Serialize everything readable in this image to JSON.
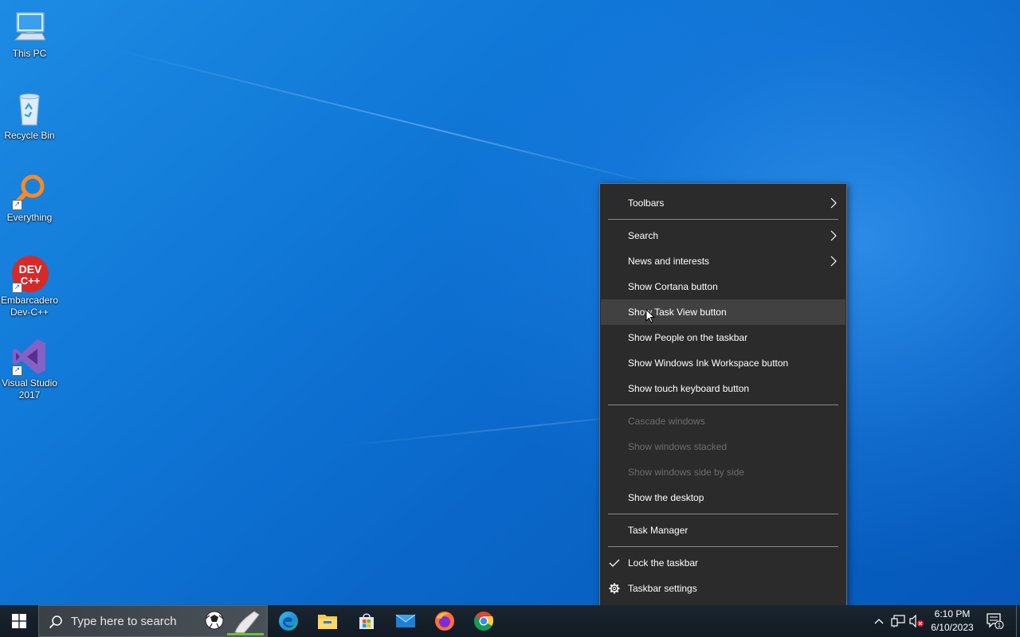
{
  "desktop": {
    "icons": [
      {
        "label": "This PC",
        "icon": "computer-icon"
      },
      {
        "label": "Recycle Bin",
        "icon": "recycle-bin-icon"
      },
      {
        "label": "Everything",
        "icon": "magnifier-icon"
      },
      {
        "label": "Embarcadero Dev-C++",
        "icon": "dev-cpp-icon",
        "badge": "DEV C++"
      },
      {
        "label": "Visual Studio 2017",
        "icon": "visual-studio-icon"
      }
    ]
  },
  "context_menu": {
    "items": [
      {
        "label": "Toolbars",
        "submenu": true
      },
      {
        "label": "Search",
        "submenu": true
      },
      {
        "label": "News and interests",
        "submenu": true
      },
      {
        "label": "Show Cortana button"
      },
      {
        "label": "Show Task View button",
        "hovered": true
      },
      {
        "label": "Show People on the taskbar"
      },
      {
        "label": "Show Windows Ink Workspace button"
      },
      {
        "label": "Show touch keyboard button"
      },
      {
        "label": "Cascade windows",
        "disabled": true
      },
      {
        "label": "Show windows stacked",
        "disabled": true
      },
      {
        "label": "Show windows side by side",
        "disabled": true
      },
      {
        "label": "Show the desktop"
      },
      {
        "label": "Task Manager"
      },
      {
        "label": "Lock the taskbar",
        "checked": true
      },
      {
        "label": "Taskbar settings",
        "icon": "gear-icon"
      }
    ]
  },
  "taskbar": {
    "search_placeholder": "Type here to search",
    "pinned": [
      "edge-icon",
      "file-explorer-icon",
      "microsoft-store-icon",
      "mail-icon",
      "firefox-icon",
      "chrome-icon"
    ],
    "clock": {
      "time": "6:10 PM",
      "date": "6/10/2023"
    },
    "notification_count": "1"
  },
  "colors": {
    "menu_bg": "#2b2b2b",
    "menu_hover": "#414141",
    "menu_disabled_text": "#6d6d6d",
    "taskbar_bg": "#15202b",
    "desktop_accent": "#0f76d6"
  }
}
